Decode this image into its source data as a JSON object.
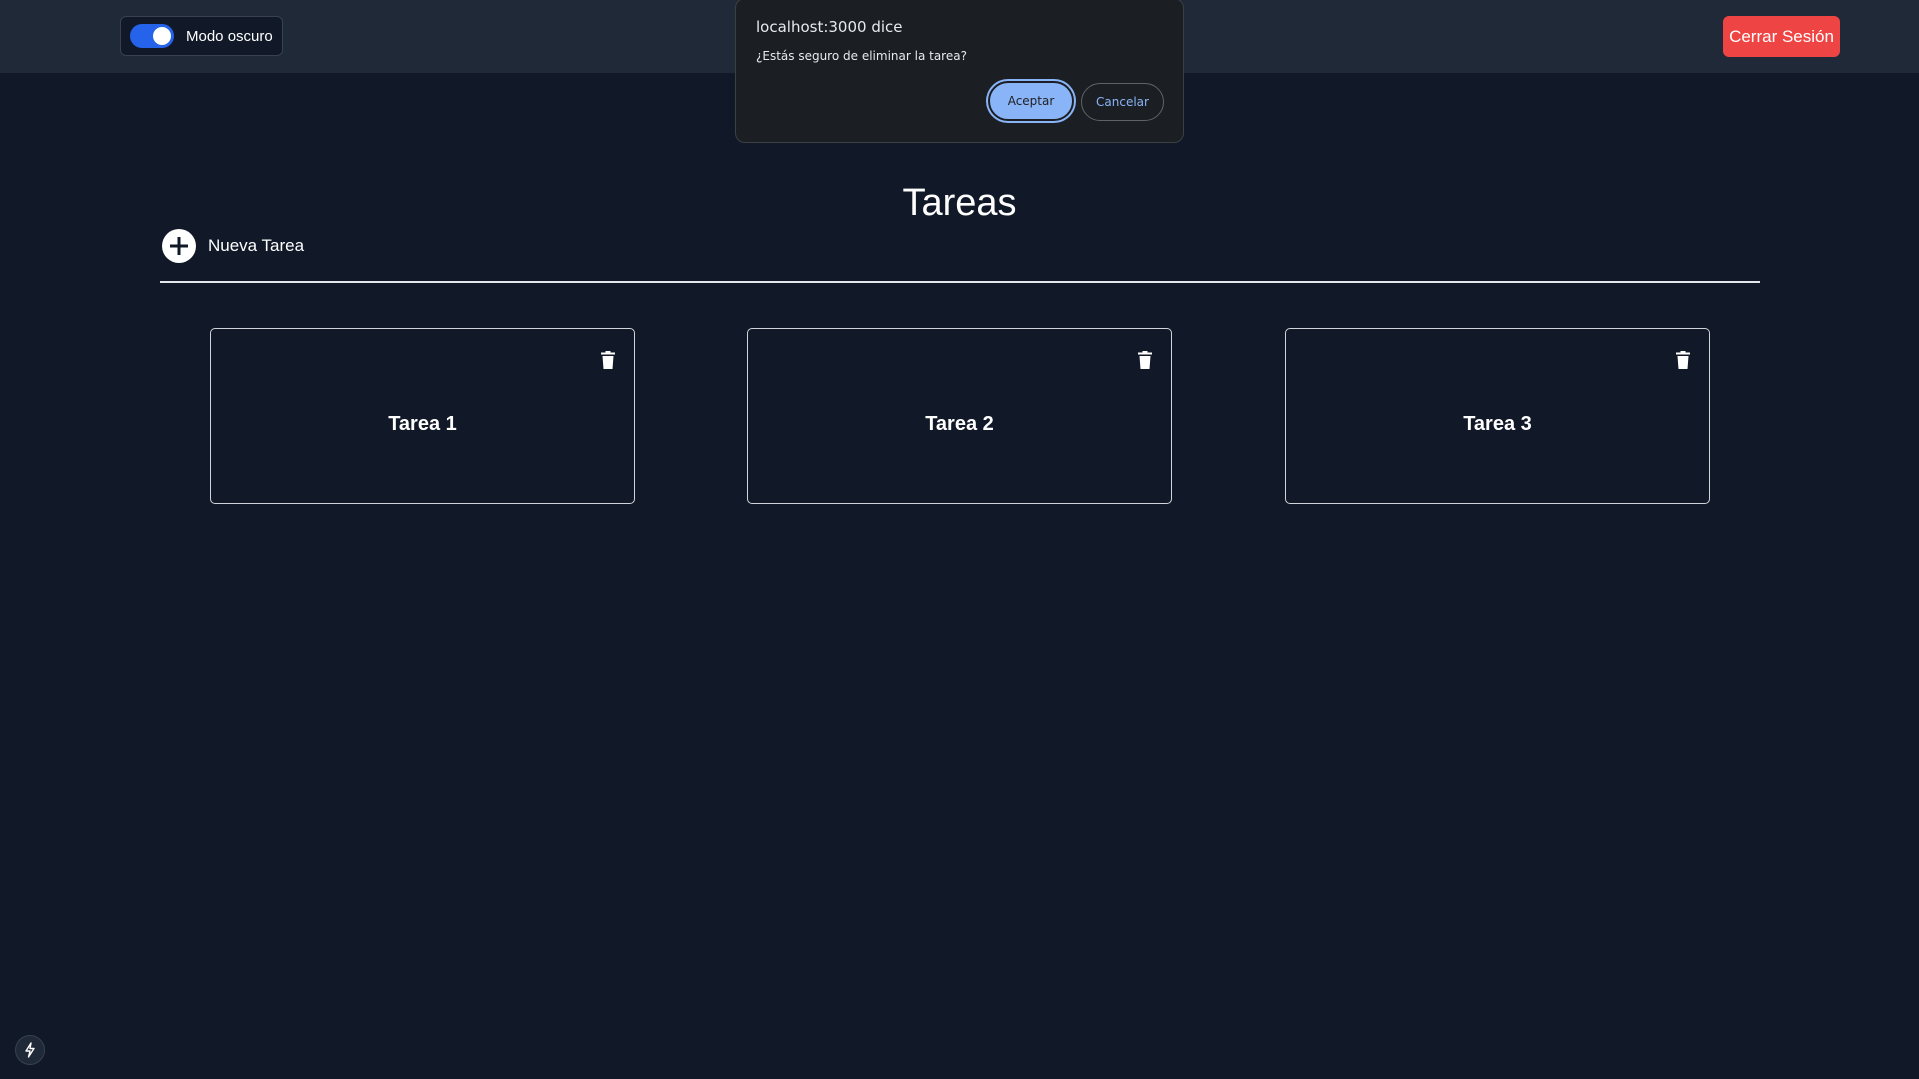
{
  "header": {
    "dark_mode_label": "Modo oscuro",
    "dark_mode_on": true,
    "logout_label": "Cerrar Sesión"
  },
  "dialog": {
    "title": "localhost:3000 dice",
    "message": "¿Estás seguro de eliminar la tarea?",
    "accept_label": "Aceptar",
    "cancel_label": "Cancelar"
  },
  "main": {
    "title": "Tareas",
    "new_task_label": "Nueva Tarea",
    "tasks": [
      {
        "title": "Tarea 1"
      },
      {
        "title": "Tarea 2"
      },
      {
        "title": "Tarea 3"
      }
    ]
  },
  "colors": {
    "background": "#111827",
    "topbar": "#1f2937",
    "toggle_accent": "#2563eb",
    "logout": "#ef4444",
    "dialog_accent": "#8ab4f8"
  },
  "icons": {
    "new_task": "plus-circle-icon",
    "delete": "trash-icon",
    "dev_badge": "lightning-bolt-icon"
  }
}
